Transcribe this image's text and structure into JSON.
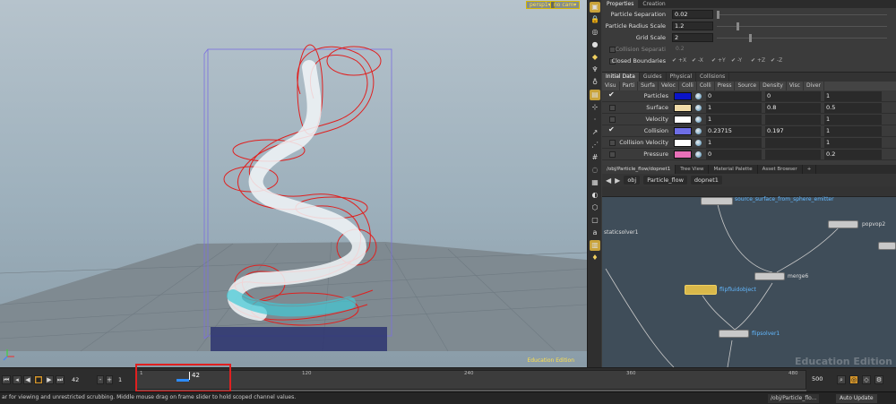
{
  "viewport": {
    "camera_label": "persp1▾",
    "cam_label": "no cam▾",
    "watermark": "Education Edition"
  },
  "props": {
    "tabs": [
      "Properties",
      "Creation"
    ],
    "rows": [
      {
        "label": "Particle Separation",
        "value": "0.02"
      },
      {
        "label": "Particle Radius Scale",
        "value": "1.2"
      },
      {
        "label": "Grid Scale",
        "value": "2"
      }
    ],
    "collision_label": "Collision Separati",
    "collision_value": "0.2",
    "boundaries_label": "Closed Boundaries",
    "axes": [
      "+X",
      "-X",
      "+Y",
      "-Y",
      "+Z",
      "-Z"
    ]
  },
  "pdata": {
    "tabs": [
      "Initial Data",
      "Guides",
      "Physical",
      "Collisions"
    ],
    "active_tab": "Initial Data",
    "columns": [
      "Visu",
      "Parti",
      "Surfa",
      "Veloc",
      "Colli",
      "Colli",
      "Press",
      "Source",
      "Density",
      "Visc",
      "Diver"
    ],
    "rows": [
      {
        "name": "Particles",
        "color": "#0a14c8",
        "checked": true,
        "v1": "0",
        "v2": "0",
        "v3": "1"
      },
      {
        "name": "Surface",
        "color": "#f0dba8",
        "checked": false,
        "v1": "1",
        "v2": "0.8",
        "v3": "0.5"
      },
      {
        "name": "Velocity",
        "color": "#ffffff",
        "checked": false,
        "v1": "1",
        "v2": "",
        "v3": "1"
      },
      {
        "name": "Collision",
        "color": "#6e6ee6",
        "checked": true,
        "v1": "0.23715",
        "v2": "0.197",
        "v3": "1"
      },
      {
        "name": "Collision Velocity",
        "color": "#ffffff",
        "checked": false,
        "v1": "1",
        "v2": "",
        "v3": "1"
      },
      {
        "name": "Pressure",
        "color": "#e870b8",
        "checked": false,
        "v1": "0",
        "v2": "",
        "v3": "0.2"
      }
    ]
  },
  "neteditor": {
    "pane_tabs": [
      "/obj/Particle_flow/dopnet1",
      "Tree View",
      "Material Palette",
      "Asset Browser"
    ],
    "crumbs": [
      "obj",
      "Particle_flow",
      "dopnet1"
    ],
    "nodes": {
      "source": "source_surface_from_sphere_emitter",
      "popvop": "popvop2",
      "static": "staticsolver1",
      "merge": "merge6",
      "flipfluid": "flipfluidobject",
      "flipsolver": "flipsolver1"
    },
    "watermark": "Education Edition"
  },
  "timeline": {
    "current_frame": "42",
    "start_frame": "1",
    "end_frame": "500",
    "playhead_label": "42",
    "ticks": [
      "1",
      "120",
      "240",
      "360",
      "480"
    ]
  },
  "status": {
    "message": "ar for viewing and unrestricted scrubbing. Middle mouse drag on frame slider to hold scoped channel values.",
    "path": "/obj/Particle_flo...",
    "auto_update": "Auto Update"
  }
}
